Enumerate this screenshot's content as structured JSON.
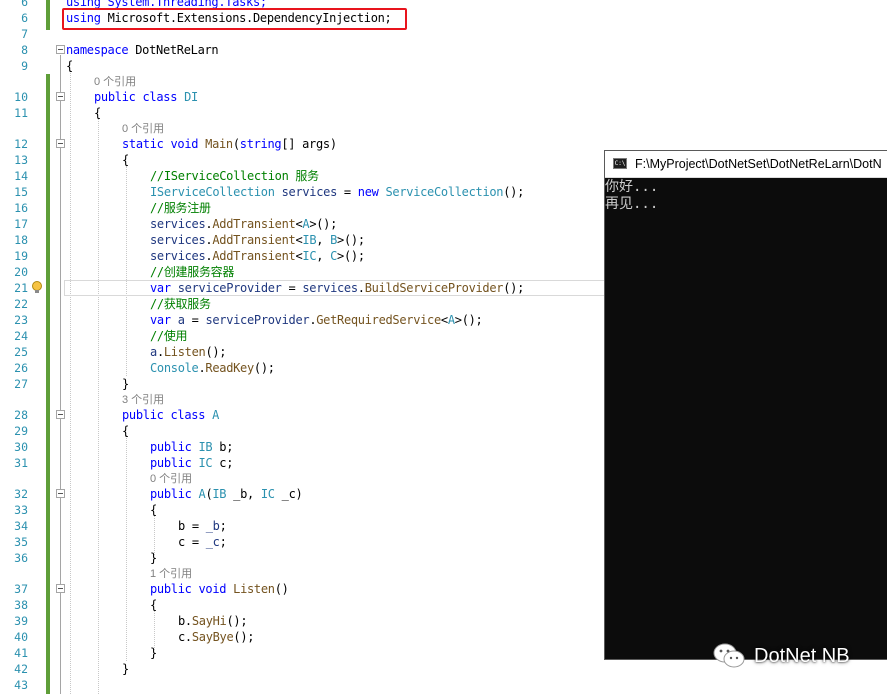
{
  "editor": {
    "line_numbers": [
      "6",
      "6",
      "7",
      "8",
      "9",
      "10",
      "11",
      "12",
      "13",
      "14",
      "15",
      "16",
      "17",
      "18",
      "19",
      "20",
      "21",
      "22",
      "23",
      "24",
      "25",
      "26",
      "27",
      "28",
      "29",
      "30",
      "31",
      "32",
      "33",
      "34",
      "35",
      "36",
      "37",
      "38",
      "39",
      "40",
      "41",
      "42",
      "43"
    ],
    "lines": [
      {
        "num": "6",
        "text": "using System.Threading.Tasks;"
      },
      {
        "num": "6",
        "text": "using Microsoft.Extensions.DependencyInjection;"
      },
      {
        "num": "7",
        "text": ""
      },
      {
        "num": "8",
        "text": "namespace DotNetReLarn"
      },
      {
        "num": "9",
        "text": "{"
      },
      {
        "lens": "0 个引用"
      },
      {
        "num": "10",
        "text": "public class DI"
      },
      {
        "num": "11",
        "text": "{"
      },
      {
        "lens": "0 个引用"
      },
      {
        "num": "12",
        "text": "static void Main(string[] args)"
      },
      {
        "num": "13",
        "text": "{"
      },
      {
        "num": "14",
        "text": "//IServiceCollection 服务"
      },
      {
        "num": "15",
        "text": "IServiceCollection services = new ServiceCollection();"
      },
      {
        "num": "16",
        "text": "//服务注册"
      },
      {
        "num": "17",
        "text": "services.AddTransient<A>();"
      },
      {
        "num": "18",
        "text": "services.AddTransient<IB, B>();"
      },
      {
        "num": "19",
        "text": "services.AddTransient<IC, C>();"
      },
      {
        "num": "20",
        "text": "//创建服务容器"
      },
      {
        "num": "21",
        "text": "var serviceProvider = services.BuildServiceProvider();"
      },
      {
        "num": "22",
        "text": "//获取服务"
      },
      {
        "num": "23",
        "text": "var a = serviceProvider.GetRequiredService<A>();"
      },
      {
        "num": "24",
        "text": "//使用"
      },
      {
        "num": "25",
        "text": "a.Listen();"
      },
      {
        "num": "26",
        "text": "Console.ReadKey();"
      },
      {
        "num": "27",
        "text": "}"
      },
      {
        "lens": "3 个引用"
      },
      {
        "num": "28",
        "text": "public class A"
      },
      {
        "num": "29",
        "text": "{"
      },
      {
        "num": "30",
        "text": "public IB b;"
      },
      {
        "num": "31",
        "text": "public IC c;"
      },
      {
        "lens": "0 个引用"
      },
      {
        "num": "32",
        "text": "public A(IB _b, IC _c)"
      },
      {
        "num": "33",
        "text": "{"
      },
      {
        "num": "34",
        "text": "b = _b;"
      },
      {
        "num": "35",
        "text": "c = _c;"
      },
      {
        "num": "36",
        "text": "}"
      },
      {
        "lens": "1 个引用"
      },
      {
        "num": "37",
        "text": "public void Listen()"
      },
      {
        "num": "38",
        "text": "{"
      },
      {
        "num": "39",
        "text": "b.SayHi();"
      },
      {
        "num": "40",
        "text": "c.SayBye();"
      },
      {
        "num": "41",
        "text": "}"
      },
      {
        "num": "42",
        "text": "}"
      },
      {
        "num": "43",
        "text": ""
      }
    ]
  },
  "console": {
    "title": "F:\\MyProject\\DotNetSet\\DotNetReLarn\\DotN",
    "icon_label": "C:\\",
    "output": [
      "你好...",
      "再见..."
    ]
  },
  "watermark": {
    "text": "DotNet NB"
  },
  "colors": {
    "keyword": "#0000ff",
    "type": "#2b91af",
    "comment": "#008000",
    "method": "#74531f",
    "highlight": "#e8141d",
    "console_bg": "#0c0c0c"
  },
  "icons": {
    "lightbulb": "lightbulb-icon",
    "wechat": "wechat-icon",
    "console": "console-icon"
  }
}
